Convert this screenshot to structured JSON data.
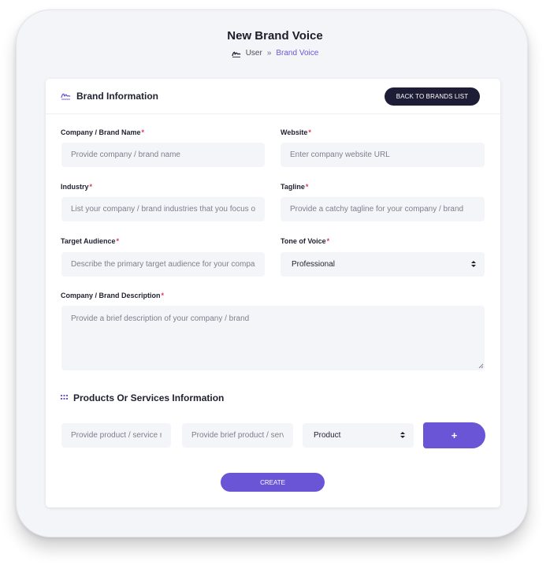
{
  "header": {
    "title": "New Brand Voice",
    "breadcrumb": {
      "root": "User",
      "separator": "»",
      "current": "Brand Voice"
    }
  },
  "brand_info": {
    "title": "Brand Information",
    "back_button": "BACK TO BRANDS LIST",
    "required_mark": "*",
    "fields": {
      "company_name": {
        "label": "Company / Brand Name",
        "placeholder": "Provide company / brand name"
      },
      "website": {
        "label": "Website",
        "placeholder": "Enter company website URL"
      },
      "industry": {
        "label": "Industry",
        "placeholder": "List your company / brand industries that you focus on"
      },
      "tagline": {
        "label": "Tagline",
        "placeholder": "Provide a catchy tagline for your company / brand"
      },
      "target_audience": {
        "label": "Target Audience",
        "placeholder": "Describe the primary target audience for your company"
      },
      "tone_of_voice": {
        "label": "Tone of Voice",
        "value": "Professional"
      },
      "description": {
        "label": "Company / Brand Description",
        "placeholder": "Provide a brief description of your company / brand"
      }
    }
  },
  "products": {
    "title": "Products Or Services Information",
    "name_placeholder": "Provide product / service name",
    "description_placeholder": "Provide brief product / service description",
    "type_value": "Product",
    "add_button": "+"
  },
  "create_button": "CREATE",
  "colors": {
    "accent": "#6a55d6",
    "dark_button": "#1d1d35",
    "required": "#e5334f",
    "field_bg": "#f4f5f9"
  },
  "icons": {
    "breadcrumb": "signature-icon",
    "brand_header": "signature-icon",
    "products": "grid-icon"
  }
}
